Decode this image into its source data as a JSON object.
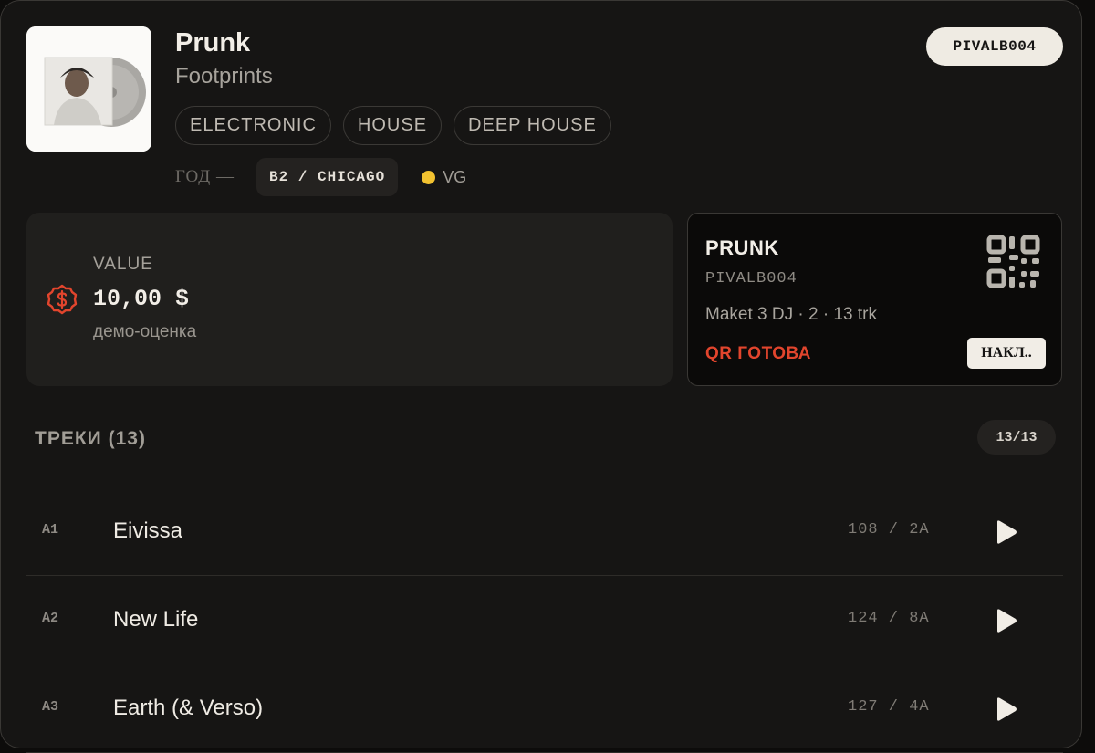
{
  "release": {
    "artist": "Prunk",
    "title": "Footprints",
    "catalog": "PIVALB004",
    "genres": [
      "ELECTRONIC",
      "HOUSE",
      "DEEP HOUSE"
    ],
    "year_label": "ГОД —",
    "label_city": "B2 / CHICAGO",
    "condition": "VG",
    "condition_color": "#f2c230",
    "cover_icon": "album-cover-image"
  },
  "value": {
    "label": "VALUE",
    "amount": "10,00 $",
    "note": "демо-оценка",
    "icon": "dollar-coin-icon",
    "accent": "#e2452d"
  },
  "label_card": {
    "artist": "PRUNK",
    "catalog": "PIVALB004",
    "description": "Maket 3 DJ · 2 · 13 trk",
    "status": "QR ГОТОВА",
    "button": "НАКЛ..",
    "icon": "qr-code-icon"
  },
  "tracks": {
    "title": "ТРЕКИ (13)",
    "count": "13/13",
    "items": [
      {
        "pos": "A1",
        "title": "Eivissa",
        "bpm_key": "108 / 2A"
      },
      {
        "pos": "A2",
        "title": "New Life",
        "bpm_key": "124 / 8A"
      },
      {
        "pos": "A3",
        "title": "Earth (& Verso)",
        "bpm_key": "127 / 4A"
      }
    ]
  }
}
